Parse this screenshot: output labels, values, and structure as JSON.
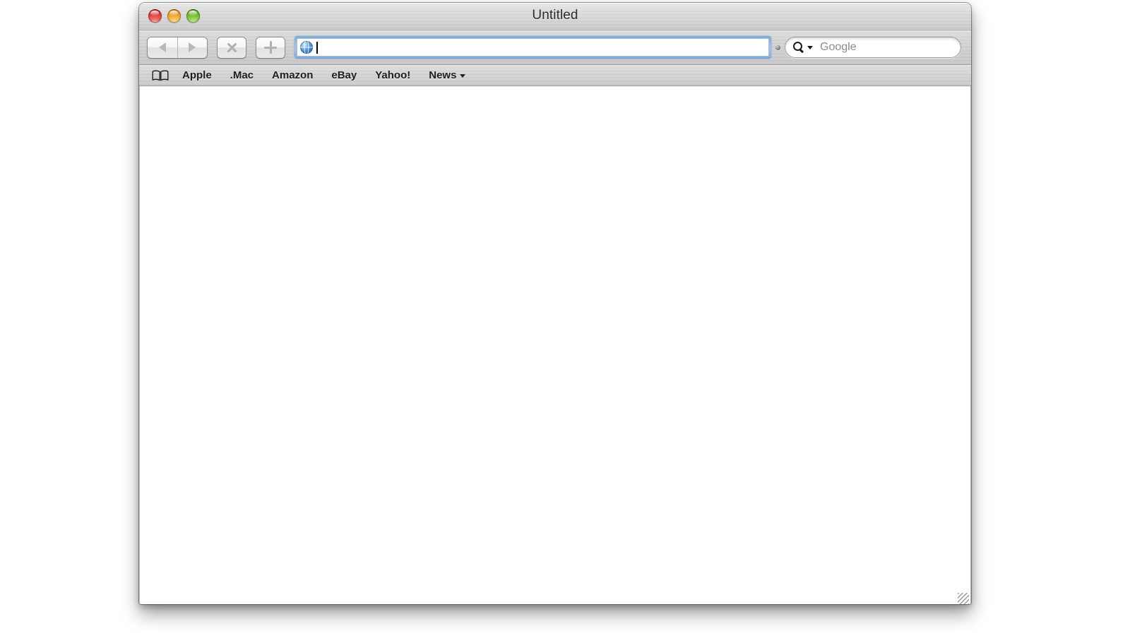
{
  "window": {
    "title": "Untitled",
    "controls": {
      "close_label": "Close",
      "minimize_label": "Minimize",
      "zoom_label": "Zoom"
    }
  },
  "toolbar": {
    "back_label": "Back",
    "forward_label": "Forward",
    "stop_label": "Stop",
    "add_bookmark_label": "Add Bookmark",
    "address": {
      "value": "",
      "placeholder": "",
      "icon": "globe-icon"
    },
    "overflow_indicator": "toolbar-overflow-dot",
    "search": {
      "value": "",
      "placeholder": "Google",
      "icon": "search-magnifier-icon",
      "menu_indicator": "chevron-down-icon"
    }
  },
  "bookmarks_bar": {
    "show_all_icon": "book-icon",
    "items": [
      {
        "label": "Apple",
        "has_menu": false
      },
      {
        "label": ".Mac",
        "has_menu": false
      },
      {
        "label": "Amazon",
        "has_menu": false
      },
      {
        "label": "eBay",
        "has_menu": false
      },
      {
        "label": "Yahoo!",
        "has_menu": false
      },
      {
        "label": "News",
        "has_menu": true
      }
    ]
  },
  "content": {
    "body_text": "",
    "resize_grip": "resize-grip"
  },
  "colors": {
    "close": "#cc2f2a",
    "minimize": "#e08d14",
    "zoom": "#5aa81f",
    "focus_ring": "#9ec2e6",
    "metal": "#c9c9c9",
    "page_background": "#ffffff"
  }
}
